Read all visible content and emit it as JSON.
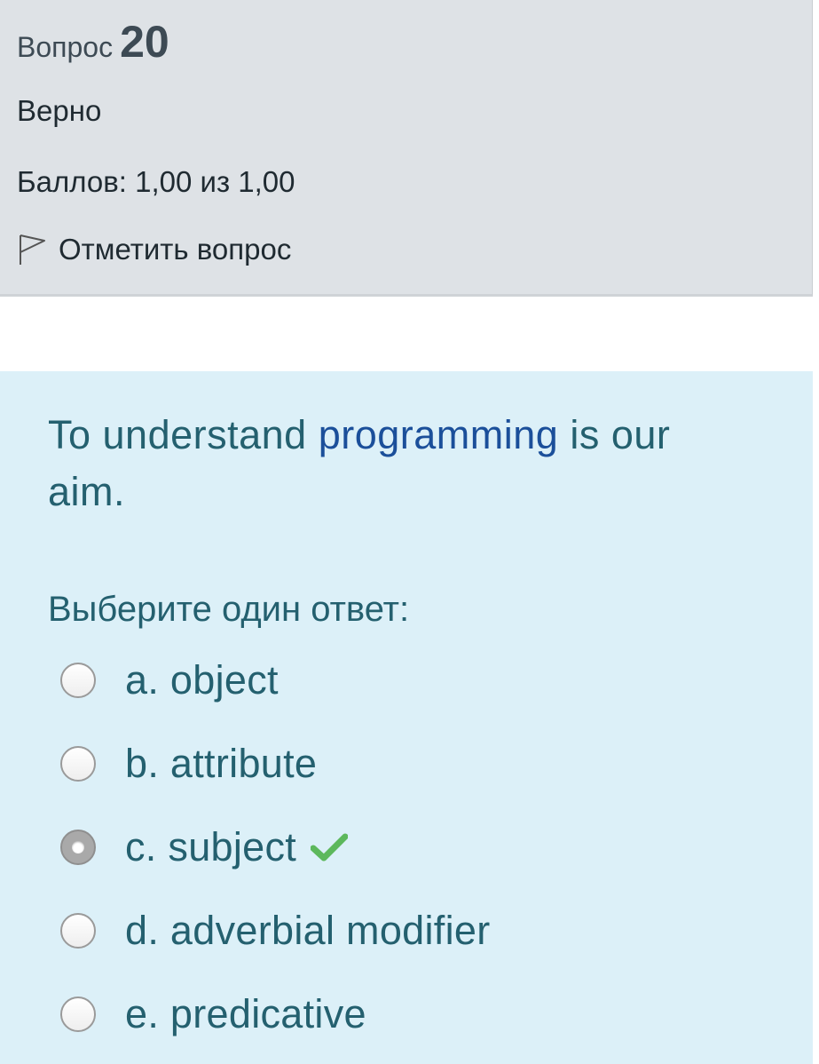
{
  "info": {
    "question_word": "Вопрос",
    "question_number": "20",
    "status": "Верно",
    "grade": "Баллов: 1,00 из 1,00",
    "flag_label": "Отметить вопрос",
    "flag_icon": "flag-icon"
  },
  "question": {
    "text_before": "To understand ",
    "text_highlight": "programming",
    "text_after": " is our aim.",
    "prompt": "Выберите один ответ:",
    "colors": {
      "text": "#24606f",
      "highlight": "#1b4f9a",
      "panel_bg": "#dcf0f8",
      "correct_mark": "#5cb85c"
    },
    "options": [
      {
        "label": "a. object",
        "selected": false
      },
      {
        "label": "b. attribute",
        "selected": false
      },
      {
        "label": "c. subject",
        "selected": true,
        "correct": true,
        "mark_icon": "check-icon"
      },
      {
        "label": "d. adverbial modifier",
        "selected": false
      },
      {
        "label": "e. predicative",
        "selected": false
      }
    ]
  }
}
